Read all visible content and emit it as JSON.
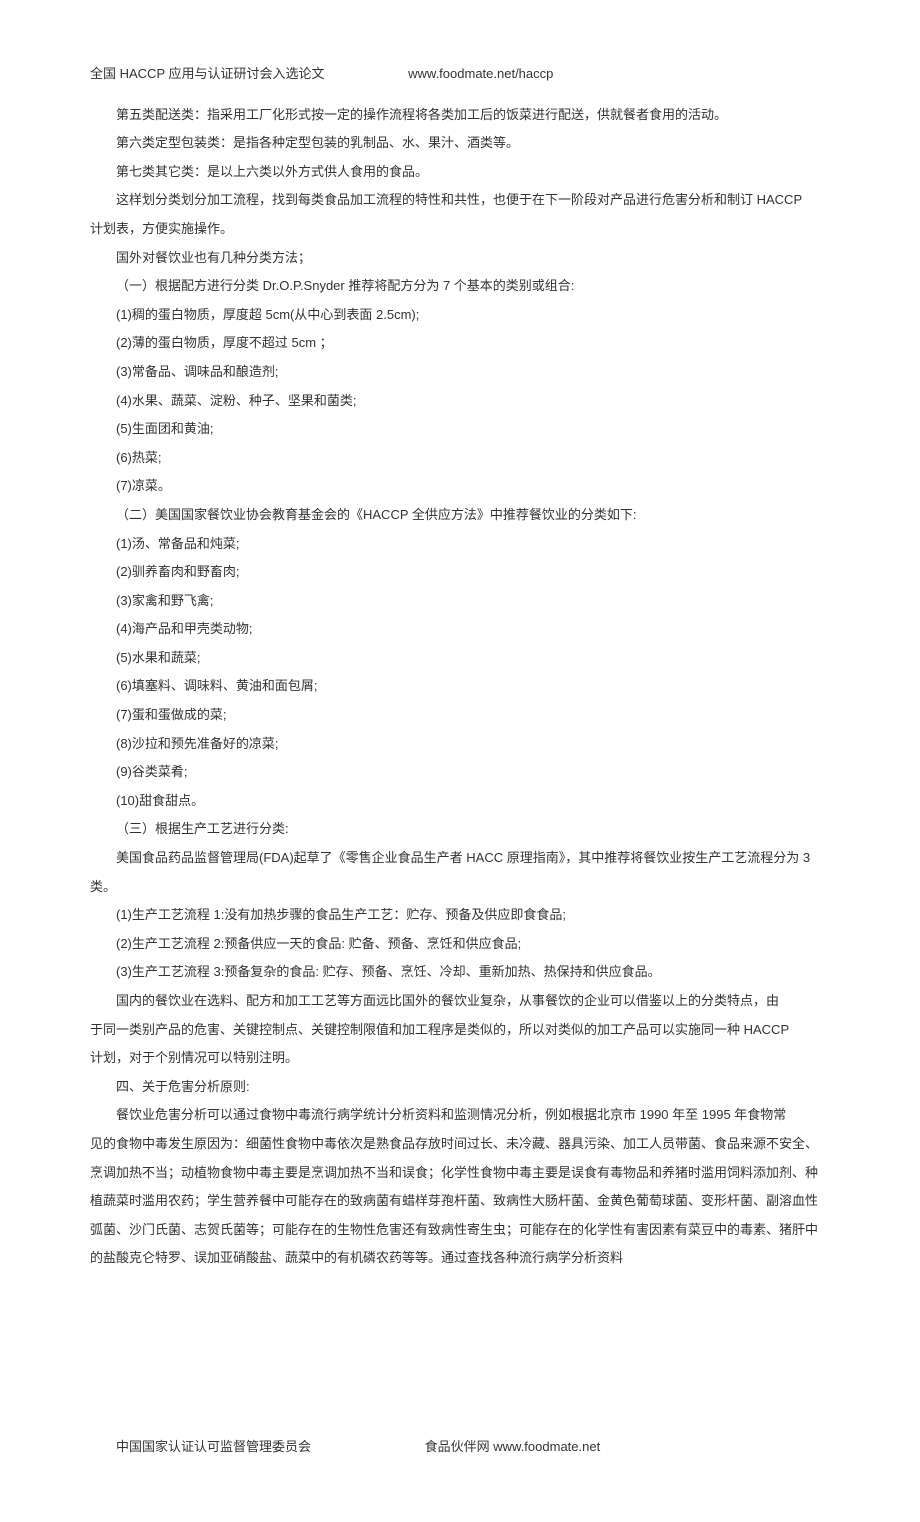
{
  "header": {
    "title": "全国 HACCP 应用与认证研讨会入选论文",
    "url": "www.foodmate.net/haccp"
  },
  "body": {
    "p1": "第五类配送类：指采用工厂化形式按一定的操作流程将各类加工后的饭菜进行配送，供就餐者食用的活动。",
    "p2": "第六类定型包装类：是指各种定型包装的乳制品、水、果汁、酒类等。",
    "p3": "第七类其它类：是以上六类以外方式供人食用的食品。",
    "p4": "这样划分类划分加工流程，找到每类食品加工流程的特性和共性，也便于在下一阶段对产品进行危害分析和制订 HACCP",
    "p4b": "计划表，方便实施操作。",
    "p5": "国外对餐饮业也有几种分类方法；",
    "p6": "（一）根据配方进行分类 Dr.O.P.Snyder 推荐将配方分为 7 个基本的类别或组合:",
    "p7": "(1)稠的蛋白物质，厚度超 5cm(从中心到表面 2.5cm);",
    "p8": "(2)薄的蛋白物质，厚度不超过 5cm ；",
    "p9": "(3)常备品、调味品和酿造剂;",
    "p10": "(4)水果、蔬菜、淀粉、种子、坚果和菌类;",
    "p11": "(5)生面团和黄油;",
    "p12": "(6)热菜;",
    "p13": "(7)凉菜。",
    "p14": "（二）美国国家餐饮业协会教育基金会的《HACCP 全供应方法》中推荐餐饮业的分类如下:",
    "p15": "(1)汤、常备品和炖菜;",
    "p16": "(2)驯养畜肉和野畜肉;",
    "p17": "(3)家禽和野飞禽;",
    "p18": "(4)海产品和甲壳类动物;",
    "p19": "(5)水果和蔬菜;",
    "p20": "(6)填塞料、调味料、黄油和面包屑;",
    "p21": "(7)蛋和蛋做成的菜;",
    "p22": "(8)沙拉和预先准备好的凉菜;",
    "p23": "(9)谷类菜肴;",
    "p24": "(10)甜食甜点。",
    "p25": "（三）根据生产工艺进行分类:",
    "p26": "美国食品药品监督管理局(FDA)起草了《零售企业食品生产者 HACC 原理指南》，其中推荐将餐饮业按生产工艺流程分为 3 类。",
    "p27": "(1)生产工艺流程 1:没有加热步骤的食品生产工艺：贮存、预备及供应即食食品;",
    "p28": "(2)生产工艺流程 2:预备供应一天的食品: 贮备、预备、烹饪和供应食品;",
    "p29": "(3)生产工艺流程 3:预备复杂的食品: 贮存、预备、烹饪、冷却、重新加热、热保持和供应食品。",
    "p30": "国内的餐饮业在选料、配方和加工工艺等方面远比国外的餐饮业复杂，从事餐饮的企业可以借鉴以上的分类特点，由",
    "p30b": "于同一类别产品的危害、关键控制点、关键控制限值和加工程序是类似的，所以对类似的加工产品可以实施同一种 HACCP",
    "p30c": "计划，对于个别情况可以特别注明。",
    "p31": "四、关于危害分析原则:",
    "p32": "餐饮业危害分析可以通过食物中毒流行病学统计分析资料和监测情况分析，例如根据北京市 1990 年至 1995 年食物常",
    "p32b": "见的食物中毒发生原因为：细菌性食物中毒依次是熟食品存放时间过长、未冷藏、器具污染、加工人员带菌、食品来源不安全、烹调加热不当；动植物食物中毒主要是烹调加热不当和误食；化学性食物中毒主要是误食有毒物品和养猪时滥用饲料添加剂、种植蔬菜时滥用农药；学生营养餐中可能存在的致病菌有蜡样芽孢杆菌、致病性大肠杆菌、金黄色葡萄球菌、变形杆菌、副溶血性弧菌、沙门氏菌、志贺氏菌等；可能存在的生物性危害还有致病性寄生虫；可能存在的化学性有害因素有菜豆中的毒素、猪肝中的盐酸克仑特罗、误加亚硝酸盐、蔬菜中的有机磷农药等等。通过查找各种流行病学分析资料"
  },
  "footer": {
    "left": "中国国家认证认可监督管理委员会",
    "right": "食品伙伴网 www.foodmate.net"
  }
}
